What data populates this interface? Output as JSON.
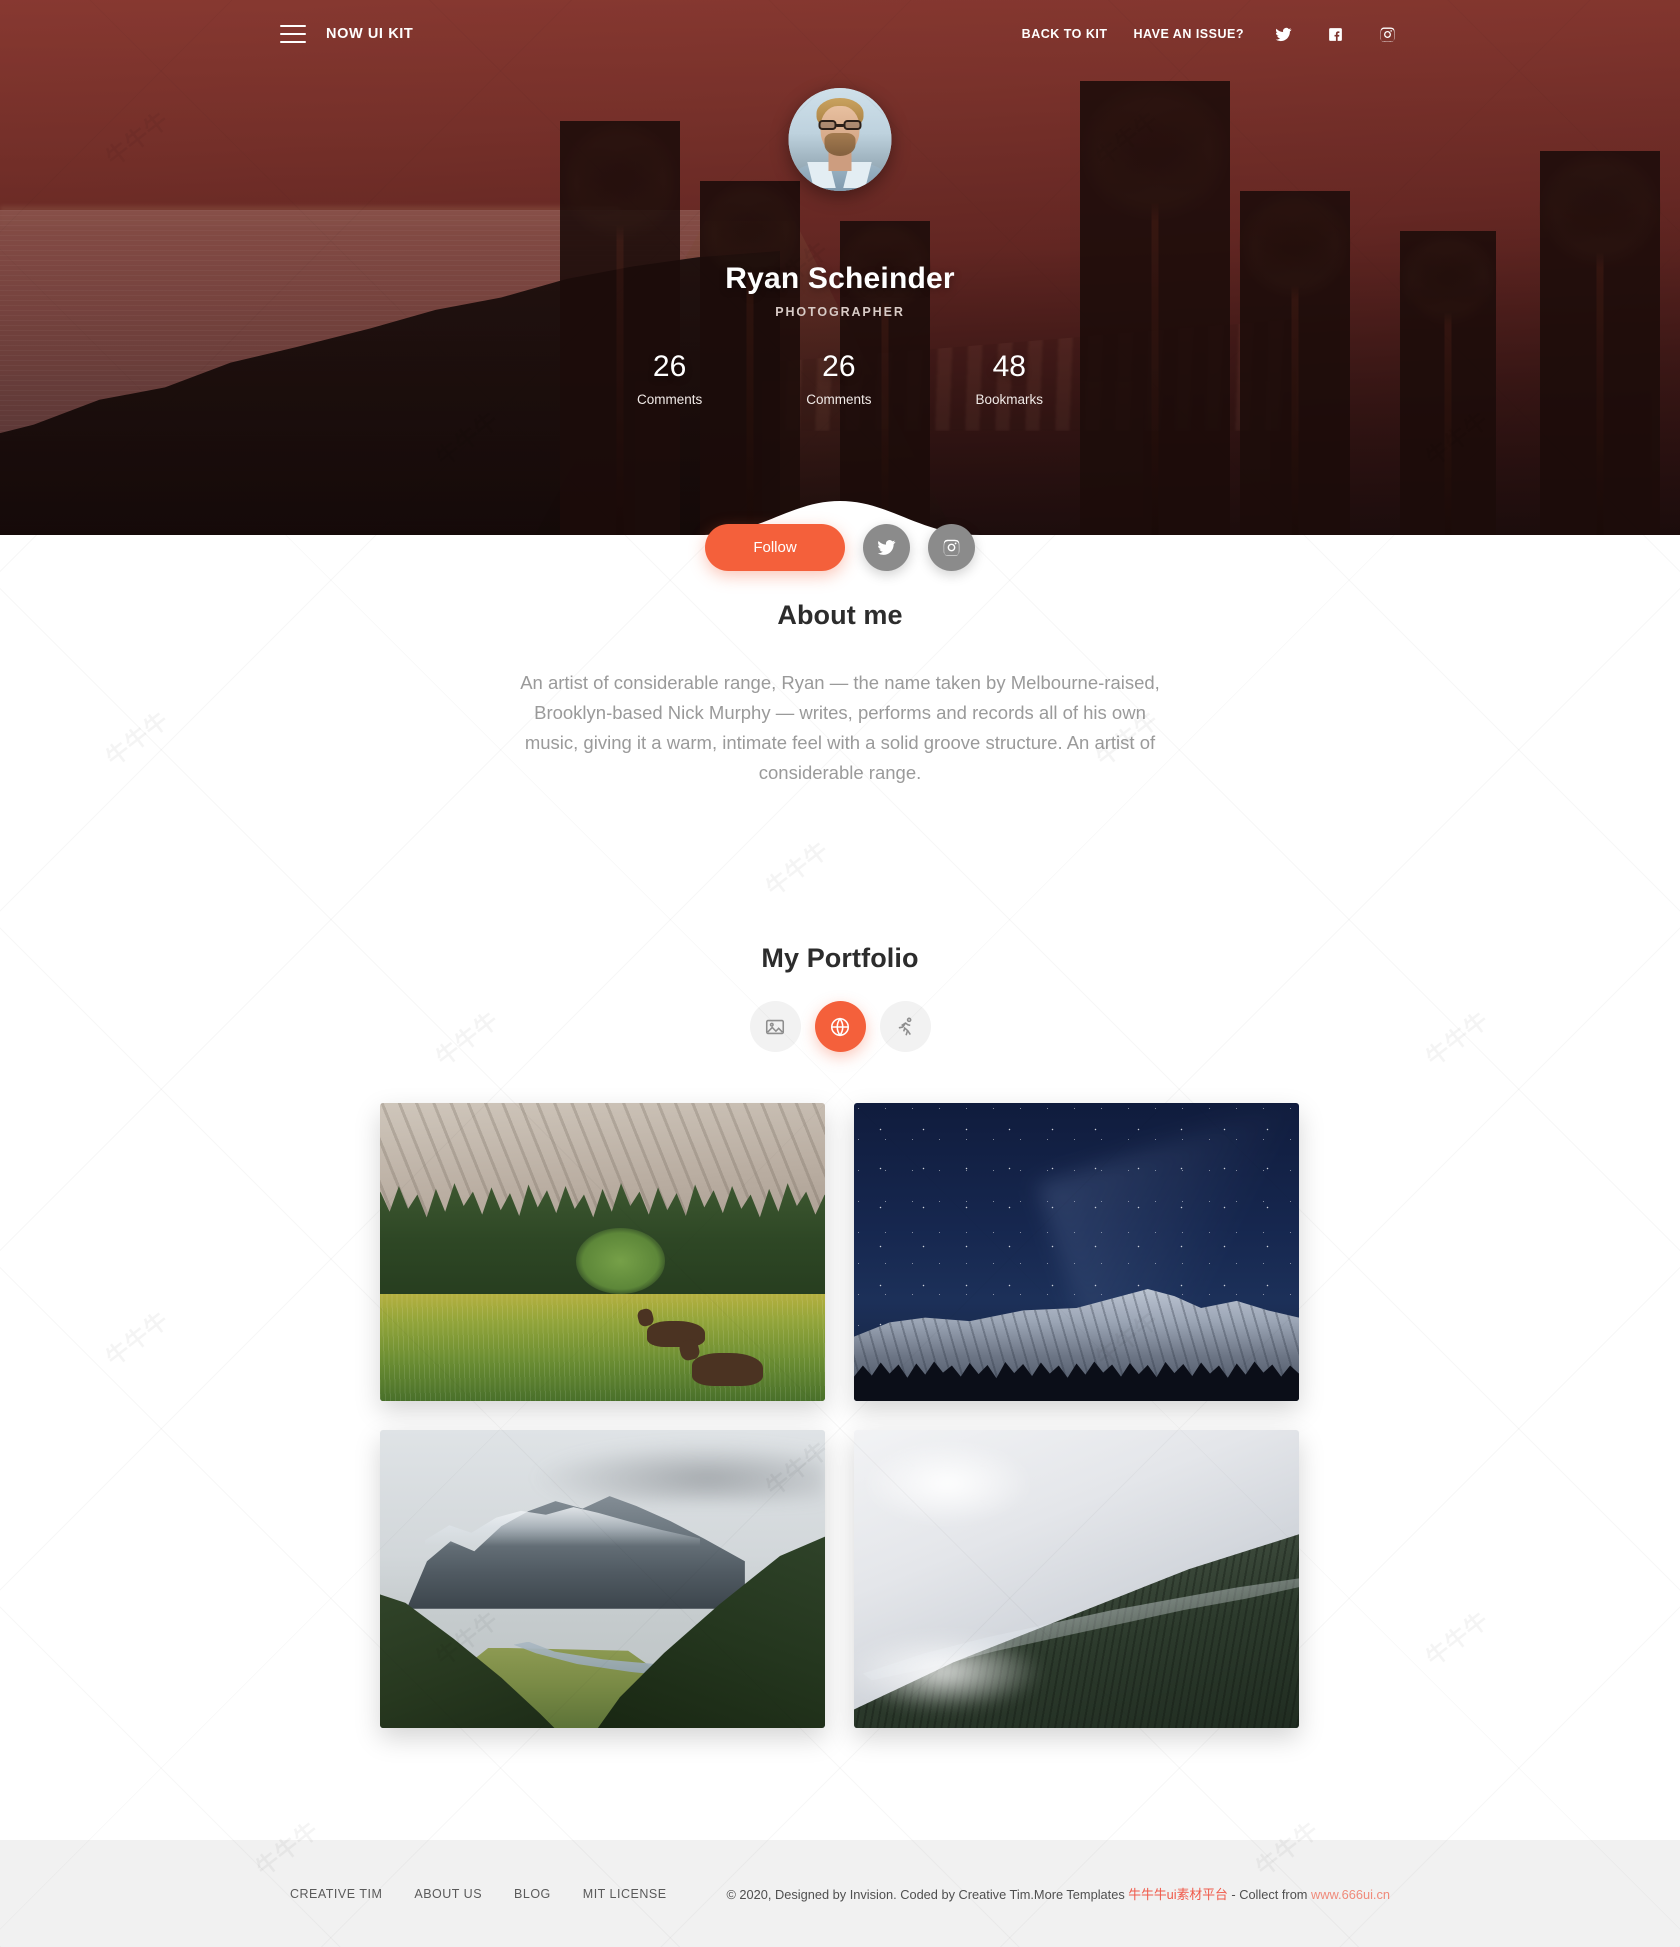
{
  "navbar": {
    "brand": "NOW UI KIT",
    "menu_icon": "hamburger-icon",
    "links": [
      {
        "label": "BACK TO KIT"
      },
      {
        "label": "HAVE AN ISSUE?"
      }
    ],
    "social": [
      {
        "name": "twitter-icon"
      },
      {
        "name": "facebook-icon"
      },
      {
        "name": "instagram-icon"
      }
    ]
  },
  "hero": {
    "avatar_alt": "profile-photo",
    "name": "Ryan Scheinder",
    "role": "PHOTOGRAPHER",
    "stats": [
      {
        "value": "26",
        "label": "Comments"
      },
      {
        "value": "26",
        "label": "Comments"
      },
      {
        "value": "48",
        "label": "Bookmarks"
      }
    ]
  },
  "actions": {
    "follow_label": "Follow",
    "twitter_icon": "twitter-icon",
    "instagram_icon": "instagram-icon"
  },
  "about": {
    "title": "About me",
    "body": "An artist of considerable range, Ryan — the name taken by Melbourne-raised, Brooklyn-based Nick Murphy — writes, performs and records all of his own music, giving it a warm, intimate feel with a solid groove structure. An artist of considerable range."
  },
  "portfolio": {
    "title": "My Portfolio",
    "filters": [
      {
        "name": "image-icon",
        "active": false
      },
      {
        "name": "globe-icon",
        "active": true
      },
      {
        "name": "running-icon",
        "active": false
      }
    ],
    "photos": [
      {
        "name": "photo-yosemite-deer-meadow"
      },
      {
        "name": "photo-starry-night-granite"
      },
      {
        "name": "photo-alpine-valley-river"
      },
      {
        "name": "photo-misty-snowy-ridge"
      }
    ]
  },
  "footer": {
    "links": [
      {
        "label": "CREATIVE TIM"
      },
      {
        "label": "ABOUT US"
      },
      {
        "label": "BLOG"
      },
      {
        "label": "MIT LICENSE"
      }
    ],
    "copyright_prefix": "© 2020, Designed by Invision. Coded by Creative Tim.More Templates ",
    "cn_site": "牛牛牛ui素材平台",
    "copyright_mid": " - Collect from ",
    "cn_url": "www.666ui.cn"
  },
  "colors": {
    "accent": "#f4603b",
    "hero_tint": "#7a3730",
    "footer_bg": "#f1f1f1",
    "muted_text": "#9a9a9a"
  }
}
